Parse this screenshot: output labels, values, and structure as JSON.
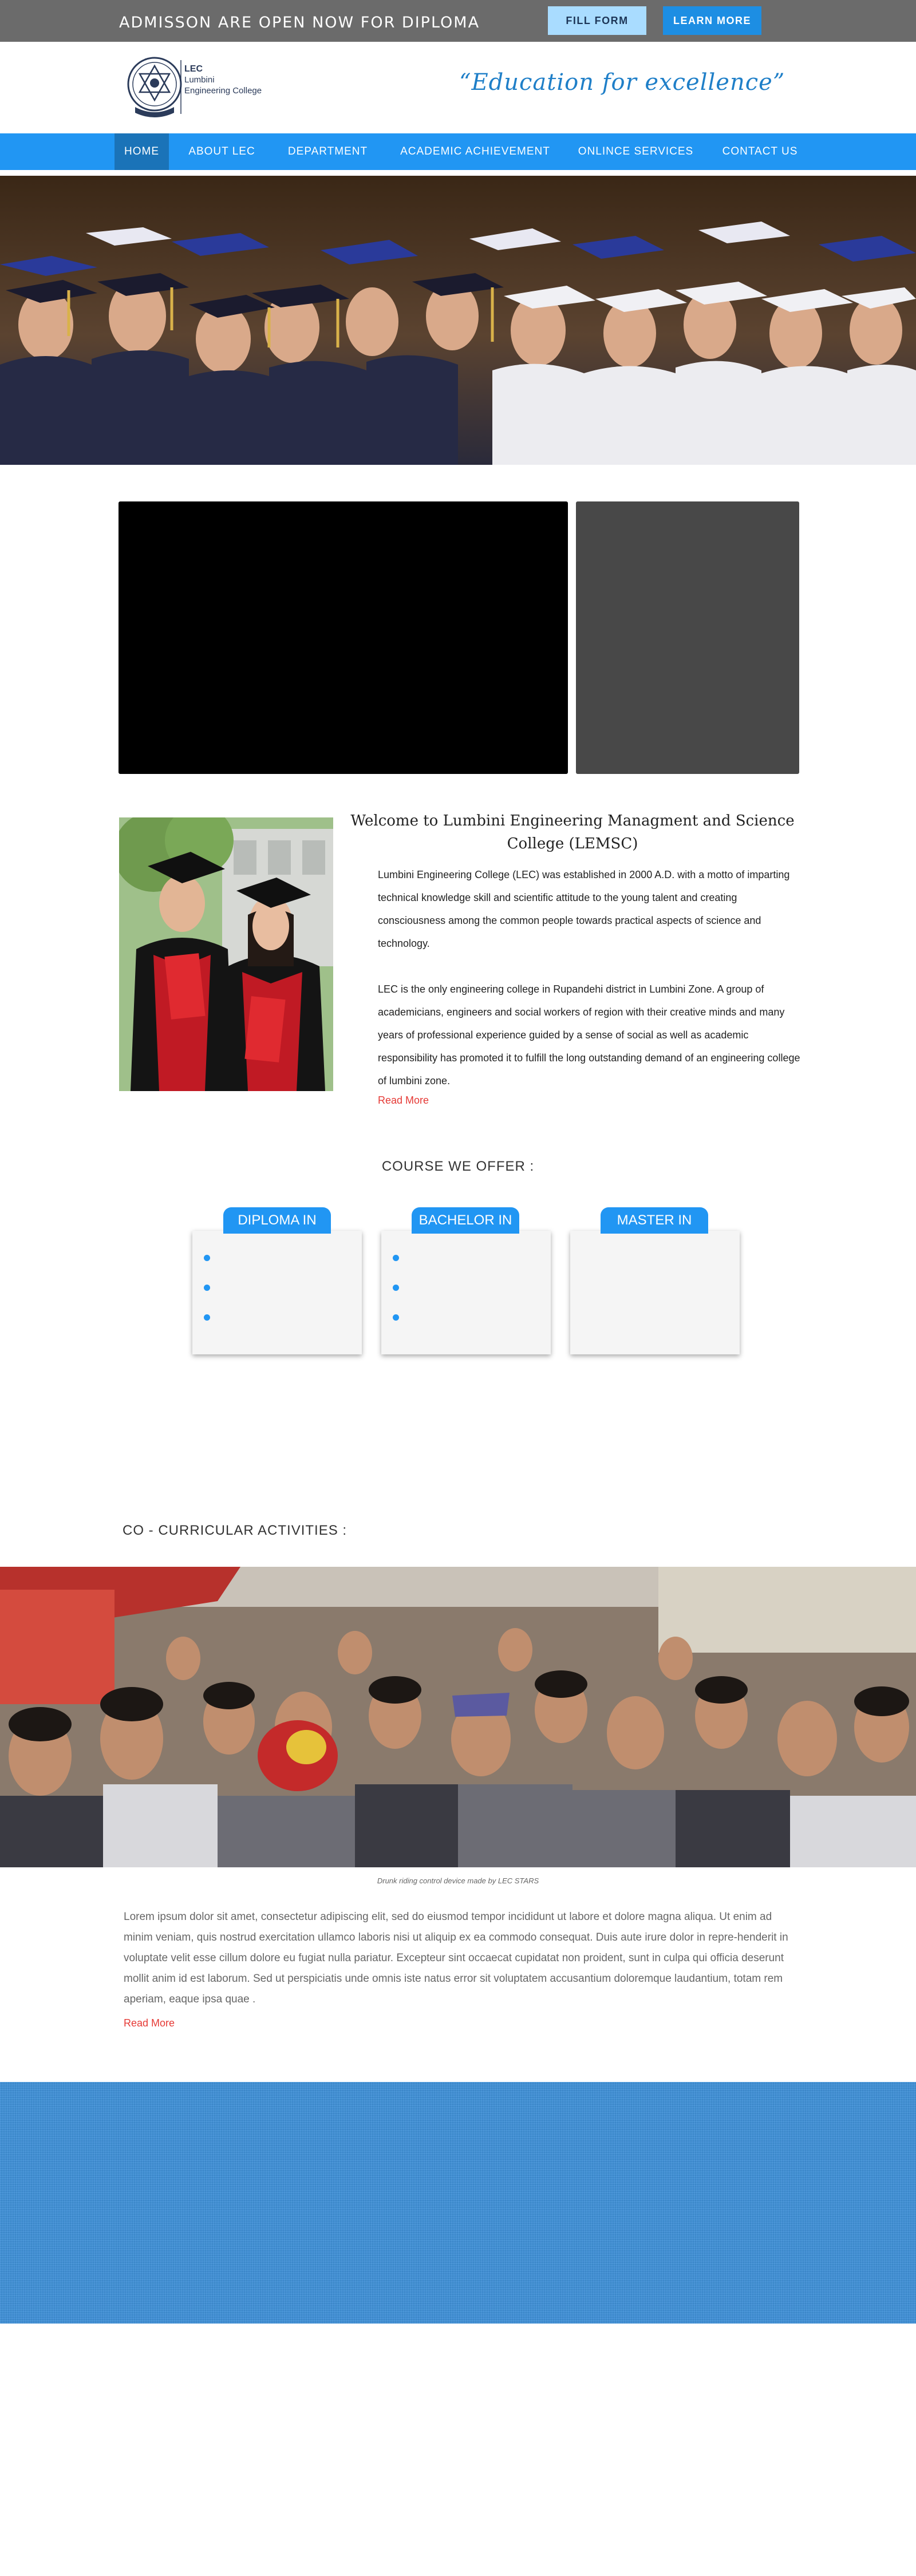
{
  "topbar": {
    "announcement": "ADMISSON ARE OPEN NOW FOR DIPLOMA",
    "fill_form_label": "FILL FORM",
    "learn_more_label": "LEARN MORE"
  },
  "header": {
    "logo_abbr": "LEC",
    "logo_name_line1": "Lumbini",
    "logo_name_line2": "Engineering College",
    "motto": "“Education for excellence”"
  },
  "nav": {
    "items": [
      {
        "label": "HOME",
        "active": true
      },
      {
        "label": "ABOUT LEC"
      },
      {
        "label": "DEPARTMENT"
      },
      {
        "label": "ACADEMIC ACHIEVEMENT"
      },
      {
        "label": "ONLINCE SERVICES"
      },
      {
        "label": "CONTACT US"
      }
    ]
  },
  "welcome": {
    "title": "Welcome to Lumbini Engineering Managment and Science College (LEMSC)",
    "paragraph1": "Lumbini Engineering College (LEC) was established in 2000 A.D. with a motto of imparting technical knowledge skill and scientific attitude to the young talent and creating consciousness among the common people towards practical aspects of science and technology.",
    "paragraph2": "LEC is the only engineering college in Rupandehi district in Lumbini Zone. A group of academicians, engineers and social workers of region with their creative minds and many years of professional experience guided by a sense of social as well as academic responsibility has promoted it to fulfill the long outstanding demand of an engineering college of lumbini zone.",
    "read_more": "Read More"
  },
  "courses": {
    "heading": "COURSE WE OFFER :",
    "items": [
      {
        "label": "DIPLOMA IN"
      },
      {
        "label": "BACHELOR IN"
      },
      {
        "label": "MASTER IN"
      }
    ]
  },
  "cocurricular": {
    "heading": "CO - CURRICULAR ACTIVITIES :",
    "caption": "Drunk riding control device made by  LEC STARS",
    "body": "Lorem ipsum dolor sit amet, consectetur adipiscing elit, sed do eiusmod tempor incididunt ut labore et dolore magna aliqua. Ut enim ad minim veniam, quis nostrud exercitation ullamco laboris nisi ut aliquip ex ea commodo consequat. Duis aute irure dolor in repre-henderit in voluptate velit esse cillum dolore eu fugiat nulla pariatur. Excepteur sint occaecat cupidatat non proident, sunt in culpa qui officia deserunt mollit anim id est laborum. Sed ut perspiciatis unde omnis iste natus error sit voluptatem accusantium doloremque laudantium, totam rem aperiam, eaque ipsa quae .",
    "read_more": "Read More"
  },
  "colors": {
    "topbar": "#6b6b6b",
    "nav": "#2196f3",
    "nav_active": "#1a73b8",
    "accent_red": "#e53935",
    "band": "#3e8fd6"
  }
}
